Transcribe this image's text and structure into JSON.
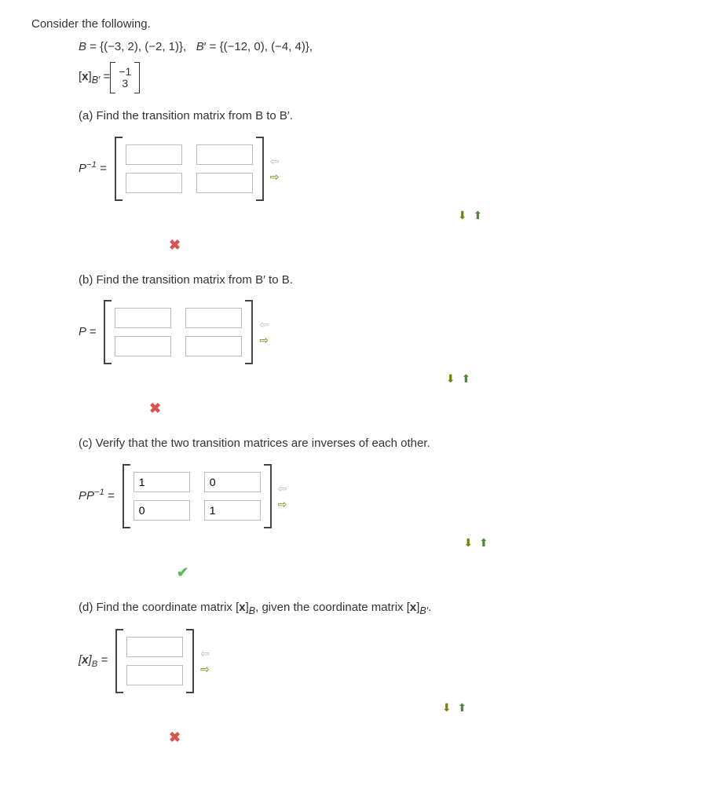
{
  "intro": "Consider the following.",
  "basis": {
    "line1_html": "B = {(−3, 2), (−2, 1)},   B′ = {(−12, 0), (−4, 4)},",
    "xbprime_label": "[x]",
    "xbprime_sub": "B′",
    "equals": " = ",
    "vec": [
      "−1",
      "3"
    ]
  },
  "parts": {
    "a": {
      "q": "(a) Find the transition matrix from B to B′.",
      "label_main": "P",
      "label_sup": "−1",
      "label_after": " = ",
      "cells": [
        [
          "",
          ""
        ],
        [
          "",
          ""
        ]
      ],
      "feedback": "wrong"
    },
    "b": {
      "q": "(b) Find the transition matrix from B′ to B.",
      "label_main": "P",
      "label_after": " = ",
      "cells": [
        [
          "",
          ""
        ],
        [
          "",
          ""
        ]
      ],
      "feedback": "wrong"
    },
    "c": {
      "q": "(c) Verify that the two transition matrices are inverses of each other.",
      "label_main": "PP",
      "label_sup": "−1",
      "label_after": " = ",
      "cells": [
        [
          "1",
          "0"
        ],
        [
          "0",
          "1"
        ]
      ],
      "feedback": "correct"
    },
    "d": {
      "q_html": "(d) Find the coordinate matrix [x]_B, given the coordinate matrix [x]_B′.",
      "label_html": "[x]_B = ",
      "cells": [
        [
          ""
        ],
        [
          ""
        ]
      ],
      "feedback": "wrong"
    }
  },
  "icons": {
    "wrong": "✖",
    "correct": "✔",
    "left": "⇦",
    "right": "⇨",
    "down": "⬇",
    "up": "⬆"
  }
}
